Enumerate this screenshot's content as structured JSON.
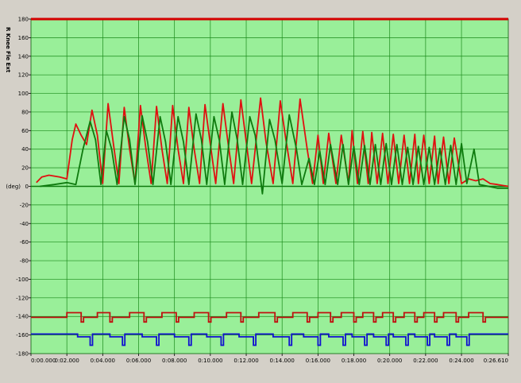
{
  "chart_data": {
    "type": "line",
    "ylabel": "R Knee Fle Ext",
    "unit_label": "(deg)",
    "ylim": [
      -180,
      180
    ],
    "xlim_seconds": [
      0,
      26.61
    ],
    "yticks": [
      180,
      160,
      140,
      120,
      100,
      80,
      60,
      40,
      20,
      0,
      -20,
      -40,
      -60,
      -80,
      -100,
      -120,
      -140,
      -160,
      -180
    ],
    "ytick_labels": [
      "180",
      "160",
      "140",
      "120",
      "100",
      "80",
      "60",
      "40",
      "20",
      "0",
      "-20",
      "-40",
      "-60",
      "-80",
      "-100",
      "-120",
      "-140",
      "-160",
      "-180"
    ],
    "xtick_values": [
      0,
      2,
      4,
      6,
      8,
      10,
      12,
      14,
      16,
      18,
      20,
      22,
      24,
      26.61
    ],
    "xtick_labels": [
      "0:00.000",
      "0:02.000",
      "0:04.000",
      "0:06.000",
      "0:08.000",
      "0:10.000",
      "0:12.000",
      "0:14.000",
      "0:16.000",
      "0:18.000",
      "0:20.000",
      "0:22.000",
      "0:24.000",
      "0:26.610"
    ],
    "grid": true,
    "background_color": "#99ef99",
    "grid_color": "#1a8a1a",
    "reference_line": {
      "y": 180,
      "color": "#d40000"
    },
    "series": [
      {
        "color": "#e01010",
        "x": [
          0.3,
          0.6,
          1.0,
          1.6,
          2.0,
          2.3,
          2.5,
          2.8,
          3.1,
          3.4,
          3.7,
          4.0,
          4.3,
          4.6,
          4.9,
          5.2,
          5.5,
          5.8,
          6.1,
          6.4,
          6.7,
          7.0,
          7.3,
          7.6,
          7.9,
          8.2,
          8.5,
          8.8,
          9.1,
          9.4,
          9.7,
          10.0,
          10.3,
          10.7,
          11.0,
          11.3,
          11.7,
          12.0,
          12.3,
          12.8,
          13.1,
          13.5,
          13.9,
          14.2,
          14.6,
          15.0,
          15.4,
          15.7,
          16.0,
          16.3,
          16.6,
          17.0,
          17.3,
          17.7,
          17.9,
          18.2,
          18.5,
          18.8,
          19.0,
          19.3,
          19.6,
          19.9,
          20.2,
          20.5,
          20.8,
          21.1,
          21.4,
          21.6,
          21.9,
          22.2,
          22.5,
          22.7,
          23.0,
          23.3,
          23.6,
          24.0,
          24.4,
          24.8,
          25.2,
          25.6,
          26.0,
          26.6
        ],
        "y": [
          4,
          10,
          12,
          10,
          8,
          50,
          67,
          55,
          45,
          82,
          55,
          3,
          89,
          45,
          3,
          85,
          40,
          3,
          87,
          42,
          3,
          86,
          40,
          3,
          87,
          40,
          3,
          85,
          40,
          3,
          88,
          45,
          3,
          89,
          45,
          3,
          93,
          48,
          3,
          95,
          48,
          3,
          92,
          52,
          3,
          94,
          40,
          3,
          55,
          3,
          57,
          3,
          55,
          3,
          60,
          3,
          59,
          3,
          58,
          3,
          57,
          3,
          56,
          3,
          55,
          3,
          56,
          3,
          55,
          3,
          54,
          3,
          53,
          3,
          52,
          3,
          8,
          6,
          8,
          3,
          2,
          0
        ]
      },
      {
        "color": "#0e7a0e",
        "x": [
          0.5,
          1.3,
          2.0,
          2.5,
          2.9,
          3.3,
          3.6,
          3.9,
          4.2,
          4.5,
          4.8,
          5.2,
          5.5,
          5.8,
          6.2,
          6.5,
          6.8,
          7.2,
          7.5,
          7.8,
          8.2,
          8.5,
          8.8,
          9.2,
          9.5,
          9.8,
          10.2,
          10.5,
          10.8,
          11.2,
          11.5,
          11.8,
          12.2,
          12.5,
          12.9,
          13.3,
          13.6,
          14.0,
          14.4,
          14.8,
          15.1,
          15.5,
          15.8,
          16.1,
          16.4,
          16.7,
          17.1,
          17.4,
          17.7,
          18.0,
          18.3,
          18.6,
          18.9,
          19.2,
          19.5,
          19.8,
          20.1,
          20.4,
          20.7,
          21.0,
          21.3,
          21.6,
          21.9,
          22.2,
          22.5,
          22.8,
          23.1,
          23.4,
          23.7,
          24.0,
          24.3,
          24.7,
          25.0,
          25.5,
          26.0,
          26.6
        ],
        "y": [
          0,
          2,
          4,
          2,
          40,
          70,
          50,
          2,
          60,
          40,
          2,
          75,
          50,
          2,
          76,
          48,
          2,
          75,
          48,
          2,
          75,
          48,
          2,
          78,
          50,
          2,
          75,
          50,
          2,
          80,
          50,
          2,
          75,
          55,
          -8,
          72,
          50,
          3,
          77,
          40,
          2,
          30,
          2,
          38,
          2,
          45,
          2,
          45,
          2,
          43,
          2,
          44,
          2,
          45,
          2,
          46,
          2,
          45,
          2,
          42,
          2,
          43,
          2,
          42,
          2,
          41,
          2,
          44,
          2,
          46,
          3,
          40,
          2,
          0,
          -2,
          -2
        ]
      }
    ],
    "event_tracks": [
      {
        "color": "#c01010",
        "base": -141,
        "high": -136,
        "low": -146,
        "pulses": [
          [
            2.0,
            2.8
          ],
          [
            3.7,
            4.4
          ],
          [
            5.5,
            6.3
          ],
          [
            7.3,
            8.1
          ],
          [
            9.1,
            9.9
          ],
          [
            10.9,
            11.7
          ],
          [
            12.7,
            13.6
          ],
          [
            14.6,
            15.4
          ],
          [
            16.0,
            16.7
          ],
          [
            17.3,
            18.0
          ],
          [
            18.5,
            19.1
          ],
          [
            19.6,
            20.2
          ],
          [
            20.8,
            21.4
          ],
          [
            21.9,
            22.5
          ],
          [
            23.0,
            23.7
          ],
          [
            24.4,
            25.2
          ]
        ]
      },
      {
        "color": "#1010d0",
        "base": -159,
        "high": -162,
        "low": -171,
        "pulses": [
          [
            2.6,
            3.3
          ],
          [
            4.4,
            5.1
          ],
          [
            6.2,
            7.0
          ],
          [
            8.0,
            8.8
          ],
          [
            9.8,
            10.6
          ],
          [
            11.6,
            12.4
          ],
          [
            13.5,
            14.4
          ],
          [
            15.2,
            16.0
          ],
          [
            16.6,
            17.4
          ],
          [
            17.9,
            18.6
          ],
          [
            19.1,
            19.8
          ],
          [
            20.2,
            20.9
          ],
          [
            21.4,
            22.1
          ],
          [
            22.5,
            23.2
          ],
          [
            23.7,
            24.3
          ]
        ]
      }
    ]
  }
}
